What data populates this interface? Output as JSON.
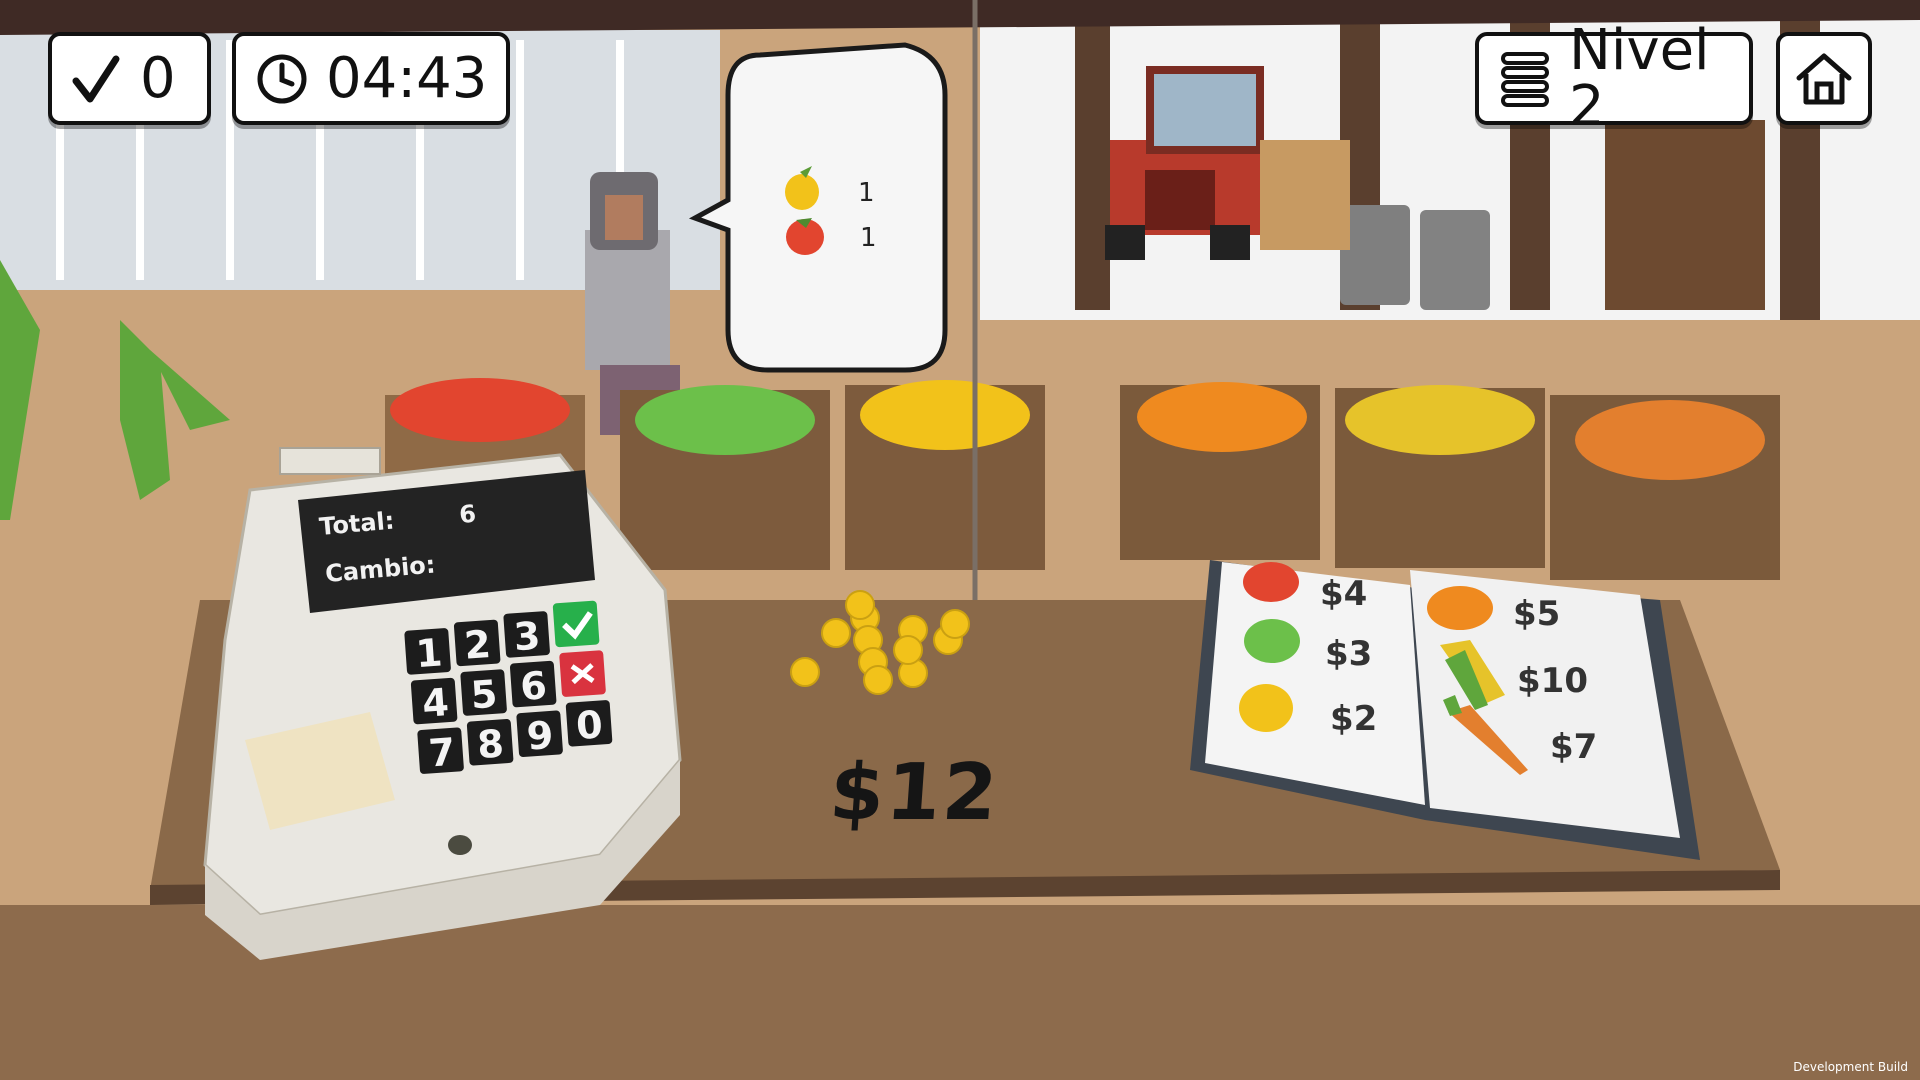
{
  "hud": {
    "score": "0",
    "timer": "04:43",
    "level": "Nivel 2",
    "icons": {
      "score": "check-icon",
      "timer": "clock-icon",
      "level": "menu-icon",
      "home": "home-icon"
    }
  },
  "customer_order": {
    "items": [
      {
        "fruit": "lemon",
        "quantity": "1"
      },
      {
        "fruit": "tomato",
        "quantity": "1"
      }
    ]
  },
  "cash_register": {
    "total_label": "Total:",
    "total_value": "6",
    "change_label": "Cambio:",
    "change_value": "",
    "keys": [
      "1",
      "2",
      "3",
      "4",
      "5",
      "6",
      "7",
      "8",
      "9",
      "0"
    ]
  },
  "counter": {
    "money_shown": "$12"
  },
  "price_book": {
    "entries": [
      {
        "item": "tomato",
        "price": "$4"
      },
      {
        "item": "apple",
        "price": "$3"
      },
      {
        "item": "lemon",
        "price": "$2"
      },
      {
        "item": "pumpkin",
        "price": "$5"
      },
      {
        "item": "corn",
        "price": "$10"
      },
      {
        "item": "carrot",
        "price": "$7"
      }
    ]
  },
  "footer": {
    "build_label": "Development Build"
  },
  "colors": {
    "hud_border": "#111111",
    "tomato": "#e2452f",
    "apple": "#6cc04a",
    "lemon": "#f2c21a",
    "pumpkin": "#ef8a1f",
    "confirm_key": "#27b04b",
    "cancel_key": "#d9333f"
  }
}
